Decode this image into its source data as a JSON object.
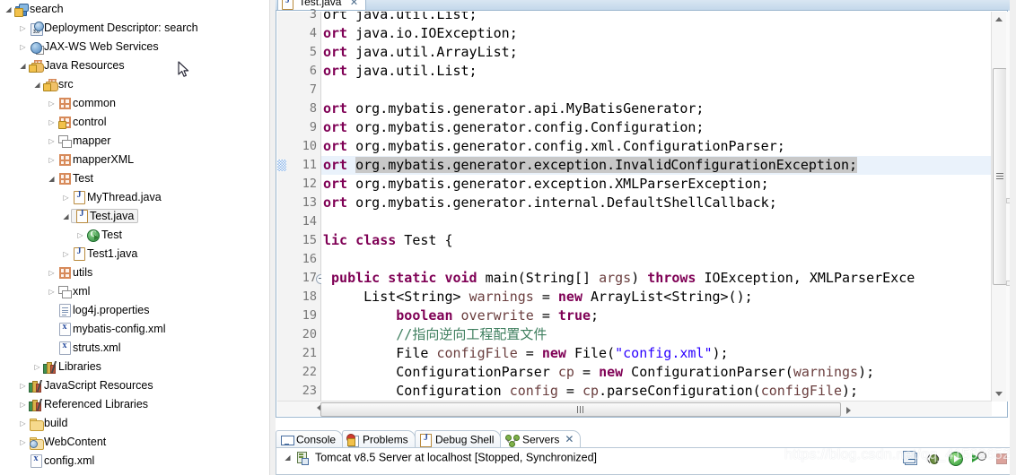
{
  "explorer": {
    "name": "package-explorer",
    "tree": [
      {
        "label": "search",
        "indent": 0,
        "arrow": "open",
        "icon": "project-icon"
      },
      {
        "label": "Deployment Descriptor: search",
        "indent": 1,
        "arrow": "closed",
        "icon": "deployment-descriptor-icon"
      },
      {
        "label": "JAX-WS Web Services",
        "indent": 1,
        "arrow": "closed",
        "icon": "web-services-icon"
      },
      {
        "label": "Java Resources",
        "indent": 1,
        "arrow": "open",
        "icon": "java-resources-icon"
      },
      {
        "label": "src",
        "indent": 2,
        "arrow": "open",
        "icon": "source-folder-icon"
      },
      {
        "label": "common",
        "indent": 3,
        "arrow": "closed",
        "icon": "package-icon"
      },
      {
        "label": "control",
        "indent": 3,
        "arrow": "closed",
        "icon": "package-warning-icon"
      },
      {
        "label": "mapper",
        "indent": 3,
        "arrow": "closed",
        "icon": "empty-package-icon"
      },
      {
        "label": "mapperXML",
        "indent": 3,
        "arrow": "closed",
        "icon": "package-icon"
      },
      {
        "label": "Test",
        "indent": 3,
        "arrow": "open",
        "icon": "package-icon"
      },
      {
        "label": "MyThread.java",
        "indent": 4,
        "arrow": "closed",
        "icon": "java-file-icon"
      },
      {
        "label": "Test.java",
        "indent": 4,
        "arrow": "open",
        "icon": "java-file-icon",
        "selected": true
      },
      {
        "label": "Test",
        "indent": 5,
        "arrow": "closed",
        "icon": "java-class-icon"
      },
      {
        "label": "Test1.java",
        "indent": 4,
        "arrow": "closed",
        "icon": "java-file-icon"
      },
      {
        "label": "utils",
        "indent": 3,
        "arrow": "closed",
        "icon": "package-icon"
      },
      {
        "label": "xml",
        "indent": 3,
        "arrow": "closed",
        "icon": "empty-package-icon"
      },
      {
        "label": "log4j.properties",
        "indent": 3,
        "arrow": "none",
        "icon": "properties-file-icon"
      },
      {
        "label": "mybatis-config.xml",
        "indent": 3,
        "arrow": "none",
        "icon": "xml-file-icon"
      },
      {
        "label": "struts.xml",
        "indent": 3,
        "arrow": "none",
        "icon": "xml-file-icon"
      },
      {
        "label": "Libraries",
        "indent": 2,
        "arrow": "closed",
        "icon": "libraries-icon"
      },
      {
        "label": "JavaScript Resources",
        "indent": 1,
        "arrow": "closed",
        "icon": "libraries-icon"
      },
      {
        "label": "Referenced Libraries",
        "indent": 1,
        "arrow": "closed",
        "icon": "libraries-icon"
      },
      {
        "label": "build",
        "indent": 1,
        "arrow": "closed",
        "icon": "folder-icon"
      },
      {
        "label": "WebContent",
        "indent": 1,
        "arrow": "closed",
        "icon": "web-folder-icon"
      },
      {
        "label": "config.xml",
        "indent": 1,
        "arrow": "none",
        "icon": "xml-file-icon"
      }
    ]
  },
  "editor": {
    "tab_label": "Test.java",
    "tab_close": "✕",
    "first_visible_line": 3,
    "lines": [
      {
        "num": 3,
        "segments": [
          {
            "t": "ort java.util.List;",
            "c": ""
          }
        ],
        "clipped": true
      },
      {
        "num": 4,
        "segments": [
          {
            "t": "ort",
            "c": "kw"
          },
          {
            "t": " java.io.IOException;",
            "c": ""
          }
        ]
      },
      {
        "num": 5,
        "segments": [
          {
            "t": "ort",
            "c": "kw"
          },
          {
            "t": " java.util.ArrayList;",
            "c": ""
          }
        ]
      },
      {
        "num": 6,
        "segments": [
          {
            "t": "ort",
            "c": "kw"
          },
          {
            "t": " java.util.List;",
            "c": ""
          }
        ]
      },
      {
        "num": 7,
        "segments": []
      },
      {
        "num": 8,
        "segments": [
          {
            "t": "ort",
            "c": "kw"
          },
          {
            "t": " org.mybatis.generator.api.MyBatisGenerator;",
            "c": ""
          }
        ]
      },
      {
        "num": 9,
        "segments": [
          {
            "t": "ort",
            "c": "kw"
          },
          {
            "t": " org.mybatis.generator.config.Configuration;",
            "c": ""
          }
        ]
      },
      {
        "num": 10,
        "segments": [
          {
            "t": "ort",
            "c": "kw"
          },
          {
            "t": " org.mybatis.generator.config.xml.ConfigurationParser;",
            "c": ""
          }
        ]
      },
      {
        "num": 11,
        "segments": [
          {
            "t": "ort",
            "c": "kw"
          },
          {
            "t": " ",
            "c": ""
          },
          {
            "t": "org.mybatis.generator.exception.Invalid",
            "c": "sel"
          },
          {
            "t": "|",
            "c": "caret"
          },
          {
            "t": "ConfigurationException;",
            "c": "sel"
          }
        ],
        "current": true
      },
      {
        "num": 12,
        "segments": [
          {
            "t": "ort",
            "c": "kw"
          },
          {
            "t": " org.mybatis.generator.exception.XMLParserException;",
            "c": ""
          }
        ]
      },
      {
        "num": 13,
        "segments": [
          {
            "t": "ort",
            "c": "kw"
          },
          {
            "t": " org.mybatis.generator.internal.DefaultShellCallback;",
            "c": ""
          }
        ]
      },
      {
        "num": 14,
        "segments": []
      },
      {
        "num": 15,
        "segments": [
          {
            "t": "lic class",
            "c": "kw"
          },
          {
            "t": " Test {",
            "c": ""
          }
        ]
      },
      {
        "num": 16,
        "segments": []
      },
      {
        "num": 17,
        "segments": [
          {
            "t": " ",
            "c": ""
          },
          {
            "t": "public static void",
            "c": "kw"
          },
          {
            "t": " main(String[] ",
            "c": ""
          },
          {
            "t": "args",
            "c": "prm"
          },
          {
            "t": ") ",
            "c": ""
          },
          {
            "t": "throws",
            "c": "kw"
          },
          {
            "t": " IOException, XMLParserExce",
            "c": ""
          }
        ],
        "fold": true
      },
      {
        "num": 18,
        "segments": [
          {
            "t": "     List<String> ",
            "c": ""
          },
          {
            "t": "warnings",
            "c": "prm"
          },
          {
            "t": " = ",
            "c": ""
          },
          {
            "t": "new",
            "c": "kw"
          },
          {
            "t": " ArrayList<String>();",
            "c": ""
          }
        ]
      },
      {
        "num": 19,
        "segments": [
          {
            "t": "         ",
            "c": ""
          },
          {
            "t": "boolean",
            "c": "kw"
          },
          {
            "t": " ",
            "c": ""
          },
          {
            "t": "overwrite",
            "c": "prm"
          },
          {
            "t": " = ",
            "c": ""
          },
          {
            "t": "true",
            "c": "kw"
          },
          {
            "t": ";",
            "c": ""
          }
        ]
      },
      {
        "num": 20,
        "segments": [
          {
            "t": "         //指向逆向工程配置文件",
            "c": "cmt"
          }
        ]
      },
      {
        "num": 21,
        "segments": [
          {
            "t": "         File ",
            "c": ""
          },
          {
            "t": "configFile",
            "c": "prm"
          },
          {
            "t": " = ",
            "c": ""
          },
          {
            "t": "new",
            "c": "kw"
          },
          {
            "t": " File(",
            "c": ""
          },
          {
            "t": "\"config.xml\"",
            "c": "str"
          },
          {
            "t": ");",
            "c": ""
          }
        ]
      },
      {
        "num": 22,
        "segments": [
          {
            "t": "         ConfigurationParser ",
            "c": ""
          },
          {
            "t": "cp",
            "c": "prm"
          },
          {
            "t": " = ",
            "c": ""
          },
          {
            "t": "new",
            "c": "kw"
          },
          {
            "t": " ConfigurationParser(",
            "c": ""
          },
          {
            "t": "warnings",
            "c": "prm"
          },
          {
            "t": ");",
            "c": ""
          }
        ]
      },
      {
        "num": 23,
        "segments": [
          {
            "t": "         Configuration ",
            "c": ""
          },
          {
            "t": "config",
            "c": "prm"
          },
          {
            "t": " = ",
            "c": ""
          },
          {
            "t": "cp",
            "c": "prm"
          },
          {
            "t": ".parseConfiguration(",
            "c": ""
          },
          {
            "t": "configFile",
            "c": "prm"
          },
          {
            "t": ");",
            "c": ""
          }
        ]
      }
    ]
  },
  "bottom": {
    "tabs": [
      {
        "label": "Console",
        "icon": "console-icon",
        "active": false,
        "closable": false
      },
      {
        "label": "Problems",
        "icon": "problems-icon",
        "active": false,
        "closable": false
      },
      {
        "label": "Debug Shell",
        "icon": "debug-shell-icon",
        "active": false,
        "closable": false
      },
      {
        "label": "Servers",
        "icon": "servers-icon",
        "active": true,
        "closable": true,
        "close": "✕"
      }
    ],
    "server_row": {
      "arrow": "open",
      "icon": "tomcat-server-icon",
      "label": "Tomcat v8.5 Server at localhost  [Stopped, Synchronized]"
    },
    "toolbar": [
      {
        "name": "collapse-all-icon"
      },
      {
        "name": "debug-icon"
      },
      {
        "name": "run-icon"
      },
      {
        "name": "profile-icon"
      },
      {
        "name": "stop-icon"
      }
    ]
  },
  "watermark": {
    "text": "https://blog.csdn.net/qq_41592652"
  },
  "colors": {
    "keyword": "#7f0055",
    "string": "#2a00ff",
    "comment": "#3f7f5f",
    "field": "#6a3e3e",
    "current_line": "#eaf2fb",
    "selection": "#c8c8c8",
    "gutter": "#f3f3f3",
    "tab_gradient_top": "#d9e6f2"
  }
}
